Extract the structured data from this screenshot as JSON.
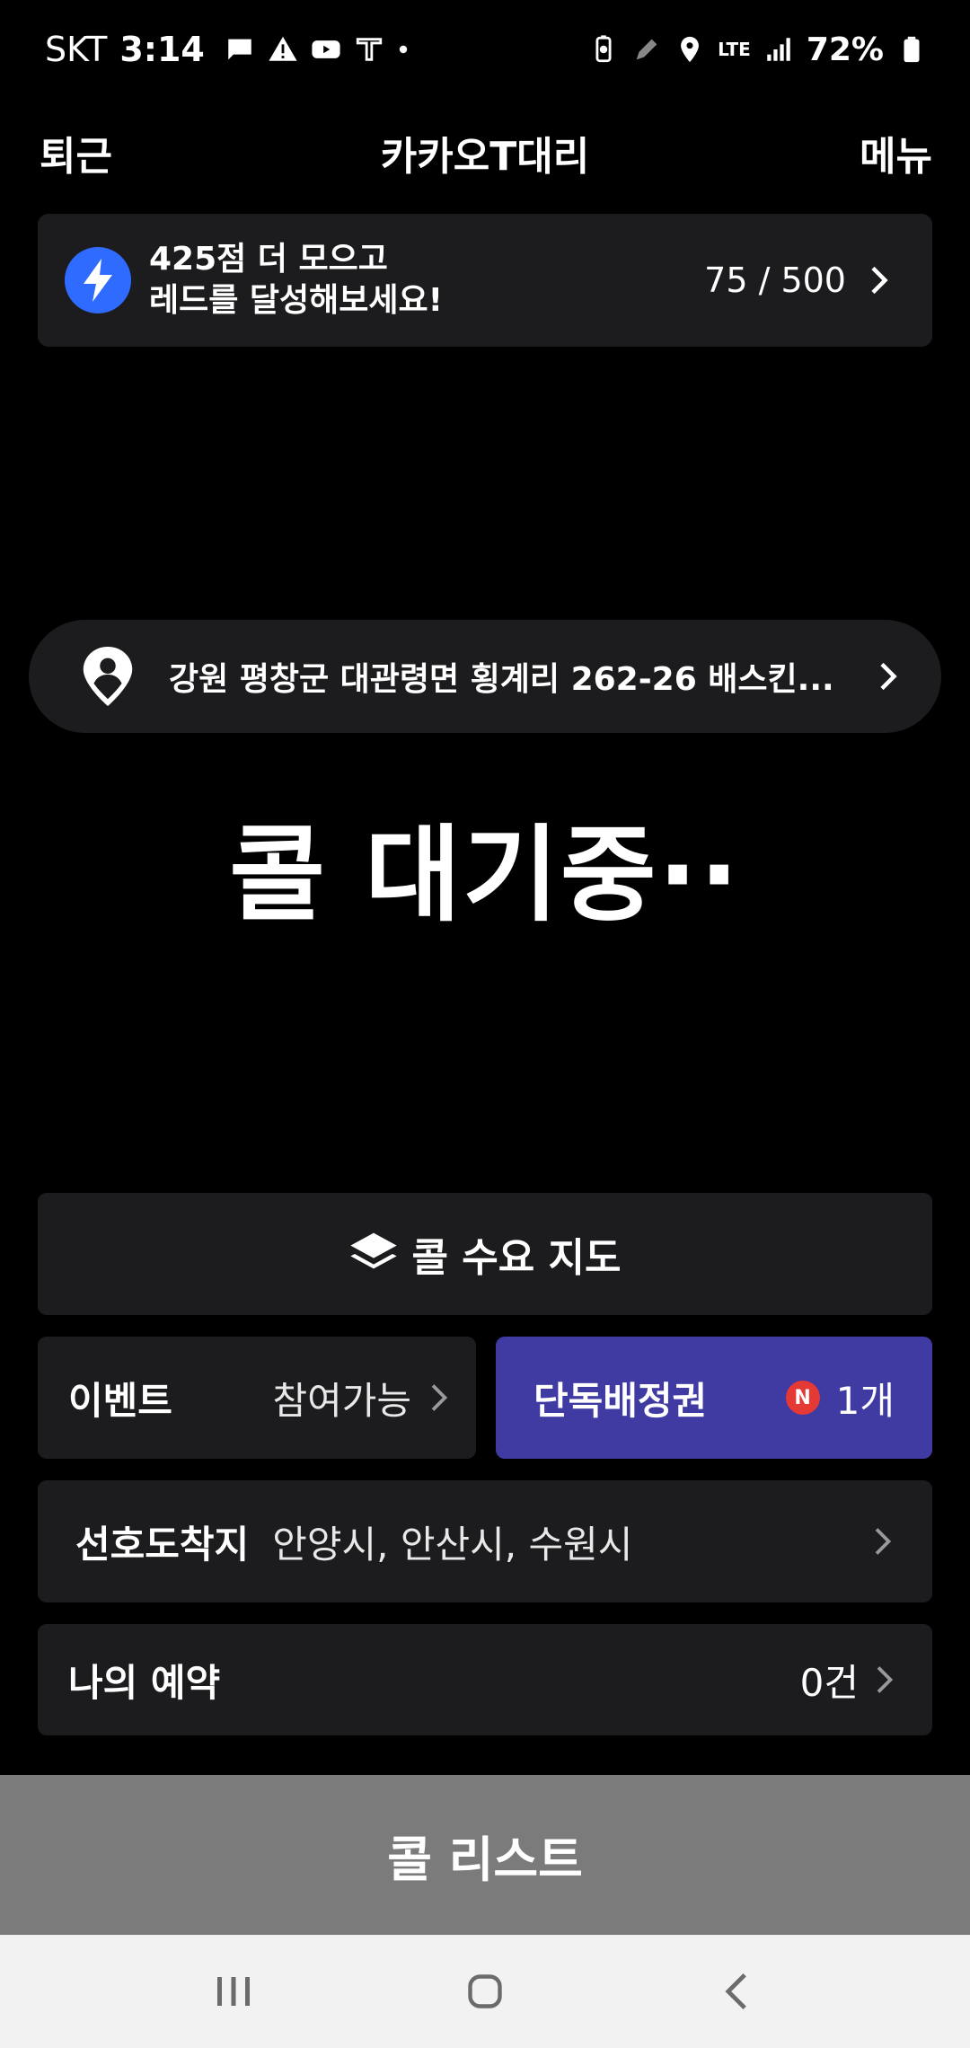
{
  "status_bar": {
    "carrier": "SKT",
    "time": "3:14",
    "network": "LTE",
    "battery": "72%"
  },
  "header": {
    "left_button": "퇴근",
    "title": "카카오T대리",
    "right_button": "메뉴"
  },
  "promo": {
    "line1": "425점 더 모으고",
    "line2": "레드를 달성해보세요!",
    "score": "75 / 500",
    "badge_color": "#2f6bff"
  },
  "location": {
    "address": "강원 평창군 대관령면 횡계리 262-26 배스킨..."
  },
  "status_message": "콜 대기중··",
  "buttons": {
    "demand_map": "콜 수요 지도",
    "event_label": "이벤트",
    "event_status": "참여가능",
    "exclusive_label": "단독배정권",
    "exclusive_badge": "N",
    "exclusive_count": "1개",
    "exclusive_color": "#3f3ba3",
    "preferred_label": "선호도착지",
    "preferred_value": "안양시, 안산시, 수원시",
    "reservation_label": "나의 예약",
    "reservation_count": "0건"
  },
  "call_list": {
    "label": "콜 리스트"
  },
  "nav": {
    "items": [
      "recents-icon",
      "home-icon",
      "back-icon"
    ]
  }
}
